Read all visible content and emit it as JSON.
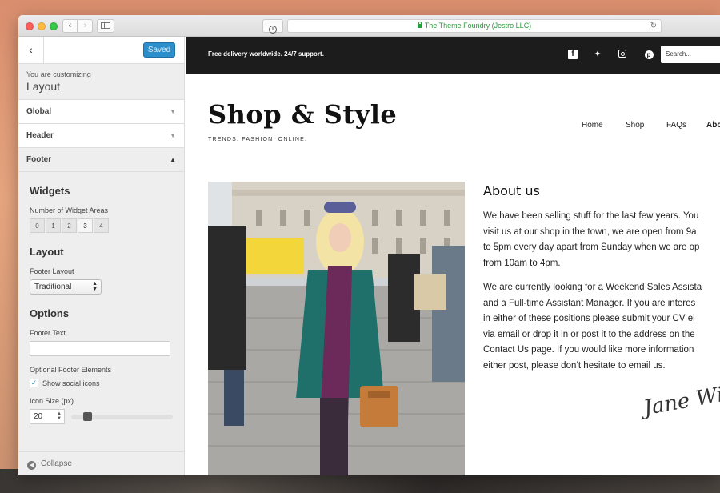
{
  "browser": {
    "url_text": "The Theme Foundry (Jestro LLC)"
  },
  "customizer": {
    "saved_label": "Saved",
    "customizing_label": "You are customizing",
    "panel_title": "Layout",
    "sections": [
      {
        "label": "Global",
        "open": false
      },
      {
        "label": "Header",
        "open": false
      },
      {
        "label": "Footer",
        "open": true
      }
    ],
    "widgets": {
      "heading": "Widgets",
      "areas_label": "Number of Widget Areas",
      "options": [
        "0",
        "1",
        "2",
        "3",
        "4"
      ],
      "selected": "3"
    },
    "layout": {
      "heading": "Layout",
      "footer_layout_label": "Footer Layout",
      "footer_layout_value": "Traditional"
    },
    "options": {
      "heading": "Options",
      "footer_text_label": "Footer Text",
      "footer_text_value": "",
      "optional_elements_label": "Optional Footer Elements",
      "social_icons_label": "Show social icons",
      "social_icons_checked": true,
      "icon_size_label": "Icon Size (px)",
      "icon_size_value": "20"
    },
    "collapse_label": "Collapse"
  },
  "site": {
    "topbar_text": "Free delivery worldwide. 24/7 support.",
    "social_icons": [
      "facebook-icon",
      "twitter-icon",
      "instagram-icon",
      "pinterest-icon"
    ],
    "search_placeholder": "Search...",
    "brand_name": "Shop & Style",
    "tagline": "TRENDS. FASHION. ONLINE.",
    "nav": [
      "Home",
      "Shop",
      "FAQs",
      "About"
    ],
    "about": {
      "heading": "About us",
      "paragraph1_lines": [
        "We have been selling stuff for the last few years. You",
        "visit us at our shop in the town, we are open from 9a",
        "to 5pm every day apart from Sunday when we are op",
        "from 10am to 4pm."
      ],
      "paragraph2_lines": [
        "We are currently looking for a Weekend Sales Assista",
        "and a Full-time Assistant Manager. If you are interes",
        "in either of these positions please submit your CV ei",
        "via email or drop it in or post it to the address on the",
        "Contact Us page. If you would like more information",
        "either post, please don’t hesitate to email us."
      ],
      "signature": "Jane Wil"
    }
  },
  "colors": {
    "accent": "#2c8ecb",
    "topbar_bg": "#1c1c1c",
    "url_green": "#2a9d3c"
  }
}
